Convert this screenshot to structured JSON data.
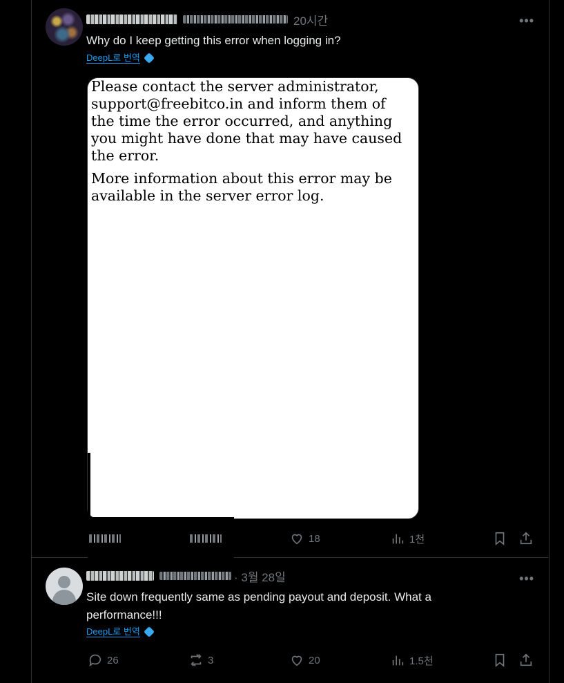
{
  "post1": {
    "time": "20시간",
    "more": "•••",
    "text": "Why do I keep getting this error when logging in?",
    "translate_label": "DeepL로 번역",
    "media": {
      "paragraph1": "Please contact the server administrator, support@freebitco.in and inform them of the time the error occurred, and anything you might have done that may have caused the error.",
      "paragraph2": "More information about this error may be available in the server error log."
    },
    "actions": {
      "likes": "18",
      "views": "1천"
    }
  },
  "post2": {
    "time": "· 3월 28일",
    "more": "•••",
    "text": "Site down frequently same as pending payout and deposit.  What a performance!!!",
    "translate_label": "DeepL로 번역",
    "actions": {
      "replies": "26",
      "reposts": "3",
      "likes": "20",
      "views": "1.5천"
    }
  },
  "icons": [
    "reply-icon",
    "repost-icon",
    "like-icon",
    "views-icon",
    "bookmark-icon",
    "share-icon",
    "deepl-icon"
  ],
  "colors": {
    "background": "#000000",
    "text": "#e7e9ea",
    "muted": "#71767b",
    "link": "#1d9bf0",
    "border": "#2f3336"
  }
}
